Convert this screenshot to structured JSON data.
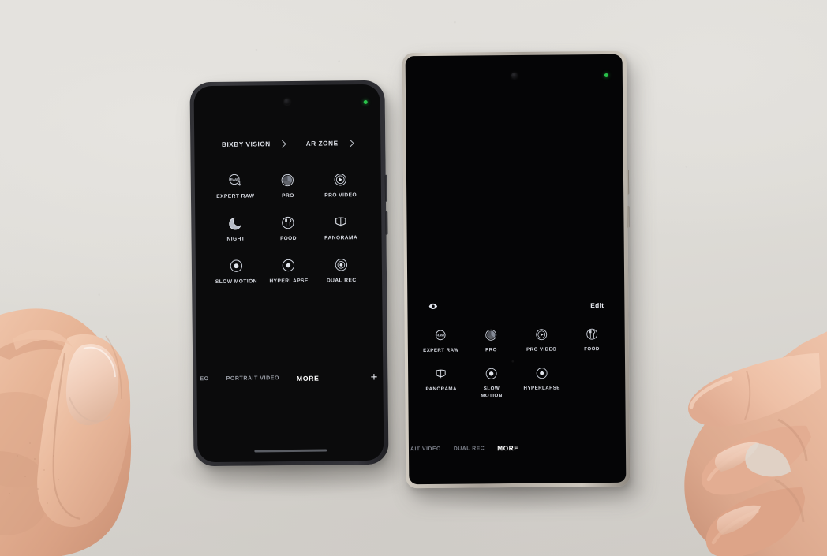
{
  "scene": {
    "description": "Two Samsung Galaxy phones side by side on a light gray desk, both showing the camera app MORE modes panel, with two hands at the edges of the frame",
    "background_color": "#dedcd7"
  },
  "left_phone": {
    "name": "Samsung Galaxy S (smaller, dark gray frame)",
    "frame_color": "#2f2f33",
    "screen_color": "#0b0b0c",
    "indicators": {
      "privacy_dot_color": "#29c24a",
      "punch_hole": "front-camera"
    },
    "shortcuts": [
      {
        "label": "BIXBY VISION",
        "chevron": "chevron-right-icon"
      },
      {
        "label": "AR ZONE",
        "chevron": "chevron-right-icon"
      }
    ],
    "modes": [
      {
        "label": "EXPERT RAW",
        "icon": "expert-raw-icon"
      },
      {
        "label": "PRO",
        "icon": "pro-icon"
      },
      {
        "label": "PRO VIDEO",
        "icon": "pro-video-icon"
      },
      {
        "label": "NIGHT",
        "icon": "night-moon-icon"
      },
      {
        "label": "FOOD",
        "icon": "food-icon"
      },
      {
        "label": "PANORAMA",
        "icon": "panorama-icon"
      },
      {
        "label": "SLOW MOTION",
        "icon": "slow-motion-icon"
      },
      {
        "label": "HYPERLAPSE",
        "icon": "hyperlapse-icon"
      },
      {
        "label": "DUAL REC",
        "icon": "dual-rec-icon"
      }
    ],
    "mode_bar": [
      {
        "label": "EO",
        "active": false
      },
      {
        "label": "PORTRAIT VIDEO",
        "active": false
      },
      {
        "label": "MORE",
        "active": true
      }
    ],
    "add_button": "+"
  },
  "right_phone": {
    "name": "Samsung Galaxy S Ultra (larger, titanium frame)",
    "frame_color": "#b9b3aa",
    "screen_color": "#050506",
    "indicators": {
      "privacy_dot_color": "#29c24a",
      "punch_hole": "front-camera"
    },
    "toolbar": {
      "eye_icon": "eye-icon",
      "edit_label": "Edit"
    },
    "modes": [
      {
        "label": "EXPERT RAW",
        "icon": "expert-raw-icon"
      },
      {
        "label": "PRO",
        "icon": "pro-icon"
      },
      {
        "label": "PRO VIDEO",
        "icon": "pro-video-icon"
      },
      {
        "label": "FOOD",
        "icon": "food-icon"
      },
      {
        "label": "PANORAMA",
        "icon": "panorama-icon"
      },
      {
        "label": "SLOW\nMOTION",
        "icon": "slow-motion-icon"
      },
      {
        "label": "HYPERLAPSE",
        "icon": "hyperlapse-icon"
      }
    ],
    "mode_bar": [
      {
        "label": "AIT VIDEO",
        "active": false
      },
      {
        "label": "DUAL REC",
        "active": false
      },
      {
        "label": "MORE",
        "active": true
      }
    ]
  },
  "hands": [
    {
      "name": "left-hand",
      "pose": "thumb up, fingers curled, at lower-left of frame"
    },
    {
      "name": "right-hand",
      "pose": "index finger pointing left toward the phones, at right of frame"
    }
  ]
}
